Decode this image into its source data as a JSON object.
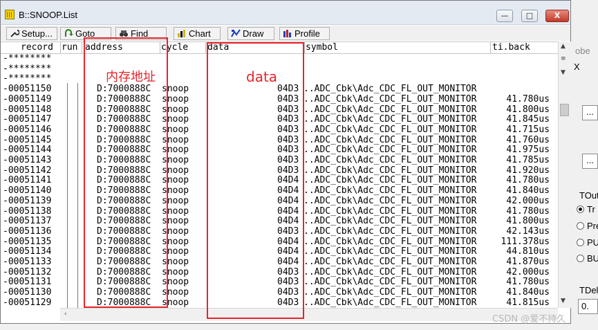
{
  "window": {
    "title": "B::SNOOP.List",
    "min_label": "—",
    "max_label": "□",
    "close_label": "X"
  },
  "toolbar": {
    "setup_label": "Setup...",
    "goto_label": "Goto",
    "find_label": "Find",
    "chart_label": "Chart",
    "draw_label": "Draw",
    "profile_label": "Profile"
  },
  "columns": {
    "record": "record",
    "run": "run",
    "address": "address",
    "cycle": "cycle",
    "data": "data",
    "symbol": "symbol",
    "tiback": "ti.back"
  },
  "rows": [
    {
      "record": "-********",
      "address": "",
      "cycle": "",
      "data": "",
      "symbol": "",
      "tiback": ""
    },
    {
      "record": "-********",
      "address": "",
      "cycle": "",
      "data": "",
      "symbol": "",
      "tiback": ""
    },
    {
      "record": "-********",
      "address": "",
      "cycle": "",
      "data": "",
      "symbol": "",
      "tiback": ""
    },
    {
      "record": "-00051150",
      "address": "D:7000888C",
      "cycle": "snoop",
      "data": "04D3",
      "symbol": "..ADC_Cbk\\Adc_CDC_FL_OUT_MONITOR",
      "tiback": ""
    },
    {
      "record": "-00051149",
      "address": "D:7000888C",
      "cycle": "snoop",
      "data": "04D3",
      "symbol": "..ADC_Cbk\\Adc_CDC_FL_OUT_MONITOR",
      "tiback": "41.780us"
    },
    {
      "record": "-00051148",
      "address": "D:7000888C",
      "cycle": "snoop",
      "data": "04D3",
      "symbol": "..ADC_Cbk\\Adc_CDC_FL_OUT_MONITOR",
      "tiback": "41.800us"
    },
    {
      "record": "-00051147",
      "address": "D:7000888C",
      "cycle": "snoop",
      "data": "04D3",
      "symbol": "..ADC_Cbk\\Adc_CDC_FL_OUT_MONITOR",
      "tiback": "41.845us"
    },
    {
      "record": "-00051146",
      "address": "D:7000888C",
      "cycle": "snoop",
      "data": "04D3",
      "symbol": "..ADC_Cbk\\Adc_CDC_FL_OUT_MONITOR",
      "tiback": "41.715us"
    },
    {
      "record": "-00051145",
      "address": "D:7000888C",
      "cycle": "snoop",
      "data": "04D3",
      "symbol": "..ADC_Cbk\\Adc_CDC_FL_OUT_MONITOR",
      "tiback": "41.760us"
    },
    {
      "record": "-00051144",
      "address": "D:7000888C",
      "cycle": "snoop",
      "data": "04D3",
      "symbol": "..ADC_Cbk\\Adc_CDC_FL_OUT_MONITOR",
      "tiback": "41.975us"
    },
    {
      "record": "-00051143",
      "address": "D:7000888C",
      "cycle": "snoop",
      "data": "04D3",
      "symbol": "..ADC_Cbk\\Adc_CDC_FL_OUT_MONITOR",
      "tiback": "41.785us"
    },
    {
      "record": "-00051142",
      "address": "D:7000888C",
      "cycle": "snoop",
      "data": "04D3",
      "symbol": "..ADC_Cbk\\Adc_CDC_FL_OUT_MONITOR",
      "tiback": "41.920us"
    },
    {
      "record": "-00051141",
      "address": "D:7000888C",
      "cycle": "snoop",
      "data": "04D4",
      "symbol": "..ADC_Cbk\\Adc_CDC_FL_OUT_MONITOR",
      "tiback": "41.780us"
    },
    {
      "record": "-00051140",
      "address": "D:7000888C",
      "cycle": "snoop",
      "data": "04D4",
      "symbol": "..ADC_Cbk\\Adc_CDC_FL_OUT_MONITOR",
      "tiback": "41.840us"
    },
    {
      "record": "-00051139",
      "address": "D:7000888C",
      "cycle": "snoop",
      "data": "04D4",
      "symbol": "..ADC_Cbk\\Adc_CDC_FL_OUT_MONITOR",
      "tiback": "42.000us"
    },
    {
      "record": "-00051138",
      "address": "D:7000888C",
      "cycle": "snoop",
      "data": "04D4",
      "symbol": "..ADC_Cbk\\Adc_CDC_FL_OUT_MONITOR",
      "tiback": "41.780us"
    },
    {
      "record": "-00051137",
      "address": "D:7000888C",
      "cycle": "snoop",
      "data": "04D4",
      "symbol": "..ADC_Cbk\\Adc_CDC_FL_OUT_MONITOR",
      "tiback": "41.800us"
    },
    {
      "record": "-00051136",
      "address": "D:7000888C",
      "cycle": "snoop",
      "data": "04D3",
      "symbol": "..ADC_Cbk\\Adc_CDC_FL_OUT_MONITOR",
      "tiback": "42.143us"
    },
    {
      "record": "-00051135",
      "address": "D:7000888C",
      "cycle": "snoop",
      "data": "04D4",
      "symbol": "..ADC_Cbk\\Adc_CDC_FL_OUT_MONITOR",
      "tiback": "111.378us"
    },
    {
      "record": "-00051134",
      "address": "D:7000888C",
      "cycle": "snoop",
      "data": "04D4",
      "symbol": "..ADC_Cbk\\Adc_CDC_FL_OUT_MONITOR",
      "tiback": "44.810us"
    },
    {
      "record": "-00051133",
      "address": "D:7000888C",
      "cycle": "snoop",
      "data": "04D4",
      "symbol": "..ADC_Cbk\\Adc_CDC_FL_OUT_MONITOR",
      "tiback": "41.870us"
    },
    {
      "record": "-00051132",
      "address": "D:7000888C",
      "cycle": "snoop",
      "data": "04D3",
      "symbol": "..ADC_Cbk\\Adc_CDC_FL_OUT_MONITOR",
      "tiback": "42.000us"
    },
    {
      "record": "-00051131",
      "address": "D:7000888C",
      "cycle": "snoop",
      "data": "04D3",
      "symbol": "..ADC_Cbk\\Adc_CDC_FL_OUT_MONITOR",
      "tiback": "41.780us"
    },
    {
      "record": "-00051130",
      "address": "D:7000888C",
      "cycle": "snoop",
      "data": "04D3",
      "symbol": "..ADC_Cbk\\Adc_CDC_FL_OUT_MONITOR",
      "tiback": "41.840us"
    },
    {
      "record": "-00051129",
      "address": "D:7000888C",
      "cycle": "snoop",
      "data": "04D3",
      "symbol": "..ADC_Cbk\\Adc_CDC_FL_OUT_MONITOR",
      "tiback": "41.815us"
    }
  ],
  "annotations": {
    "address_label": "内存地址",
    "data_label": "data",
    "box_color": "#e8232b"
  },
  "side_panel": {
    "frag_obe": "obe",
    "frag_x": "X",
    "ellipsis_1": "...",
    "ellipsis_2": "...",
    "tout_label": "TOut",
    "radio_1": "Tr",
    "radio_2": "Pre",
    "radio_3": "PU",
    "radio_4": "BU",
    "tdel_label": "TDel",
    "tdel_value": "0."
  },
  "watermark": "CSDN @爱不持久"
}
